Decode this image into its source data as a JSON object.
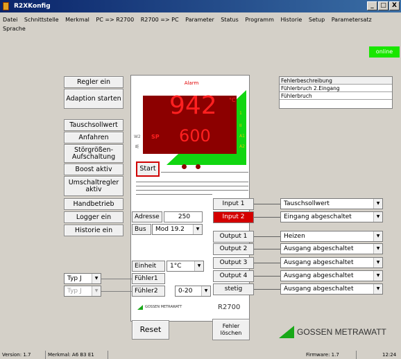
{
  "window": {
    "title": "R2XKonfig",
    "min": "_",
    "max": "□",
    "close": "X"
  },
  "menu": [
    "Datei",
    "Schnittstelle",
    "Merkmal",
    "PC => R2700",
    "R2700 => PC",
    "Parameter",
    "Status",
    "Programm",
    "Historie",
    "Setup",
    "Parametersatz",
    "Sprache"
  ],
  "status_indicator": "online",
  "left_buttons": [
    "Regler ein",
    "Adaption starten",
    "Tauschsollwert",
    "Anfahren",
    "Störgrößen-Aufschaltung",
    "Boost aktiv",
    "Umschaltregler aktiv",
    "Handbetrieb",
    "Logger ein",
    "Historie ein"
  ],
  "device": {
    "alarm": "Alarm",
    "pv": "942",
    "unit": "°C",
    "sp_label": "SP",
    "sp": "600",
    "w2": "W2",
    "start": "Start",
    "ind": [
      "1",
      "II",
      "A1",
      "A2"
    ],
    "brand": "GOSSEN METRAWATT",
    "model": "R2700"
  },
  "fault": {
    "header": "Fehlerbeschreibung",
    "items": [
      "Fühlerbruch 2.Eingang",
      "Fühlerbruch"
    ]
  },
  "config": {
    "adresse_label": "Adresse",
    "adresse_value": "250",
    "bus_label": "Bus",
    "bus_value": "Mod 19.2",
    "einheit_label": "Einheit",
    "einheit_value": "1°C",
    "fuehler1_label": "Fühler1",
    "fuehler2_label": "Fühler2",
    "fuehler2_value": "0-20",
    "typ1": "Typ J",
    "typ2": "Typ J"
  },
  "io": [
    {
      "label": "Input 1",
      "value": "Tauschsollwert"
    },
    {
      "label": "Input 2",
      "value": "Eingang abgeschaltet"
    },
    {
      "label": "Output 1",
      "value": "Heizen"
    },
    {
      "label": "Output 2",
      "value": "Ausgang abgeschaltet"
    },
    {
      "label": "Output 3",
      "value": "Ausgang abgeschaltet"
    },
    {
      "label": "Output 4",
      "value": "Ausgang abgeschaltet"
    },
    {
      "label": "stetig",
      "value": "Ausgang abgeschaltet"
    }
  ],
  "bottom": {
    "reset": "Reset",
    "fehler": "Fehler löschen",
    "logo": "GOSSEN METRAWATT"
  },
  "statusbar": {
    "version": "Version: 1.7",
    "merkmal": "Merkmal: A6 B3 E1",
    "firmware": "Firmware: 1.7",
    "time": "12:24"
  }
}
